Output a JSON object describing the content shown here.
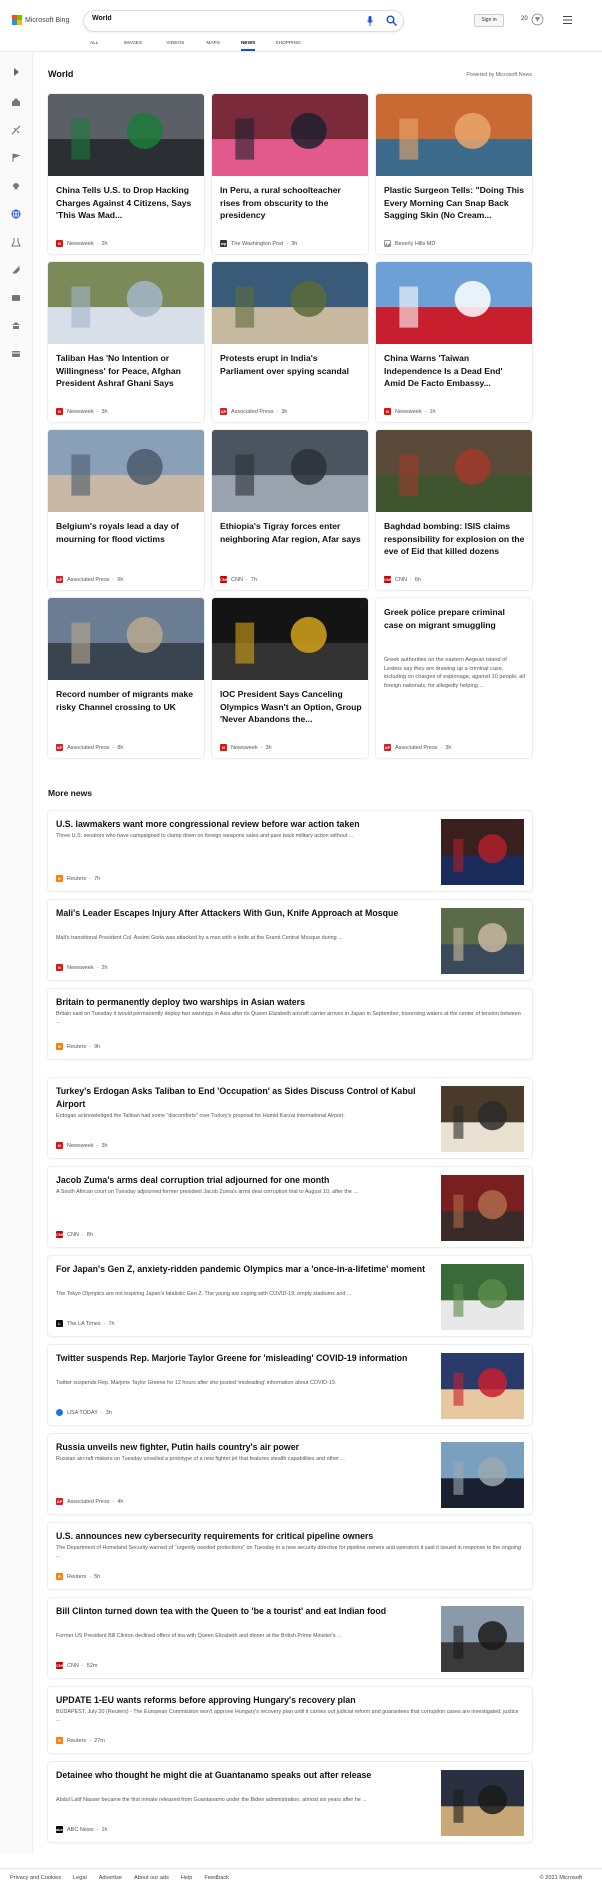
{
  "header": {
    "logo_text": "Microsoft Bing",
    "search_value": "World",
    "sign_in": "Sign in",
    "points": "20",
    "tabs": [
      "ALL",
      "IMAGES",
      "VIDEOS",
      "MAPS",
      "NEWS",
      "SHOPPING"
    ],
    "active_tab": "NEWS"
  },
  "sidebar": {
    "icons": [
      "expand-icon",
      "home-icon",
      "discover-icon",
      "flag-icon",
      "location-icon",
      "globe-icon",
      "science-icon",
      "rocket-icon",
      "entertainment-icon",
      "bank-icon",
      "card-icon"
    ]
  },
  "world": {
    "title": "World",
    "powered_by": "Powered by Microsoft News",
    "cards": [
      {
        "headline": "China Tells U.S. to Drop Hacking Charges Against 4 Citizens, Says 'This Was Mad...",
        "source": "Newsweek",
        "time": "2h",
        "logo": "N",
        "logo_color": "#e3120b"
      },
      {
        "headline": "In Peru, a rural schoolteacher rises from obscurity to the presidency",
        "source": "The Washington Post",
        "time": "3h",
        "logo": "wp",
        "logo_color": "#333333"
      },
      {
        "headline": "Plastic Surgeon Tells: \"Doing This Every Morning Can Snap Back Sagging Skin (No Cream...",
        "source": "Beverly Hills MD",
        "time": "",
        "logo": "Ad",
        "logo_color": "#cccccc"
      },
      {
        "headline": "Taliban Has 'No Intention or Willingness' for Peace, Afghan President Ashraf Ghani Says",
        "source": "Newsweek",
        "time": "3h",
        "logo": "N",
        "logo_color": "#e3120b"
      },
      {
        "headline": "Protests erupt in India's Parliament over spying scandal",
        "source": "Associated Press",
        "time": "3h",
        "logo": "AP",
        "logo_color": "#e31b23"
      },
      {
        "headline": "China Warns 'Taiwan Independence Is a Dead End' Amid De Facto Embassy...",
        "source": "Newsweek",
        "time": "1h",
        "logo": "N",
        "logo_color": "#e3120b"
      },
      {
        "headline": "Belgium's royals lead a day of mourning for flood victims",
        "source": "Associated Press",
        "time": "6h",
        "logo": "AP",
        "logo_color": "#e31b23"
      },
      {
        "headline": "Ethiopia's Tigray forces enter neighboring Afar region, Afar says",
        "source": "CNN",
        "time": "7h",
        "logo": "CNN",
        "logo_color": "#cc0000"
      },
      {
        "headline": "Baghdad bombing: ISIS claims responsibility for explosion on the eve of Eid that killed dozens",
        "source": "CNN",
        "time": "6h",
        "logo": "CNN",
        "logo_color": "#cc0000"
      },
      {
        "headline": "Record number of migrants make risky Channel crossing to UK",
        "source": "Associated Press",
        "time": "8h",
        "logo": "AP",
        "logo_color": "#e31b23"
      },
      {
        "headline": "IOC President Says Canceling Olympics Wasn't an Option, Group 'Never Abandons the...",
        "source": "Newsweek",
        "time": "3h",
        "logo": "N",
        "logo_color": "#e3120b"
      }
    ],
    "text_card": {
      "headline": "Greek police prepare criminal case on migrant smuggling",
      "snippet": "Greek authorities on the eastern Aegean island of Lesbos say they are drawing up a criminal case, including on charges of espionage, against 10 people, all foreign nationals, for allegedly helping ...",
      "source": "Associated Press",
      "time": "3h",
      "logo": "AP",
      "logo_color": "#e31b23"
    }
  },
  "more_news": {
    "title": "More news",
    "items": [
      {
        "title": "U.S. lawmakers want more congressional review before war action taken",
        "snippet": "Three U.S. senators who have campaigned to clamp down on foreign weapons sales and pare back military action without ...",
        "source": "Reuters",
        "time": "7h",
        "logo": "R",
        "logo_color": "#ff8000",
        "thumb": true
      },
      {
        "title": "Mali's Leader Escapes Injury After Attackers With Gun, Knife Approach at Mosque",
        "snippet": "Mali's transitional President Col. Assimi Goita was attacked by a man with a knife at the Grand Central Mosque during ...",
        "source": "Newsweek",
        "time": "2h",
        "logo": "N",
        "logo_color": "#e3120b",
        "thumb": true
      },
      {
        "title": "Britain to permanently deploy two warships in Asian waters",
        "snippet": "Britain said on Tuesday it would permanently deploy two warships in Asia after its Queen Elizabeth aircraft carrier arrives in Japan in September, traversing waters at the center of tension between ...",
        "source": "Reuters",
        "time": "9h",
        "logo": "R",
        "logo_color": "#ff8000",
        "thumb": false
      },
      {
        "title": "Turkey's Erdogan Asks Taliban to End 'Occupation' as Sides Discuss Control of Kabul Airport",
        "snippet": "Erdogan acknowledged the Taliban had some \"discomforts\" over Turkey's proposal for Hamid Karzai International Airport.",
        "source": "Newsweek",
        "time": "3h",
        "logo": "N",
        "logo_color": "#e3120b",
        "thumb": true
      },
      {
        "title": "Jacob Zuma's arms deal corruption trial adjourned for one month",
        "snippet": "A South African court on Tuesday adjourned former president Jacob Zuma's arms deal corruption trial to August 10, after the ...",
        "source": "CNN",
        "time": "8h",
        "logo": "CNN",
        "logo_color": "#cc0000",
        "thumb": true
      },
      {
        "title": "For Japan's Gen Z, anxiety-ridden pandemic Olympics mar a 'once-in-a-lifetime' moment",
        "snippet": "The Tokyo Olympics are not inspiring Japan's fatalistic Gen Z. The young are coping with COVID-19, empty stadiums and ...",
        "source": "The LA Times",
        "time": "7h",
        "logo": "L",
        "logo_color": "#111111",
        "thumb": true
      },
      {
        "title": "Twitter suspends Rep. Marjorie Taylor Greene for 'misleading' COVID-19 information",
        "snippet": "Twitter suspends Rep. Marjorie Taylor Greene for 12 hours after she posted 'misleading' information about COVID-19.",
        "source": "USA TODAY",
        "time": "3h",
        "logo": "",
        "logo_color": "#1a73e8",
        "thumb": true
      },
      {
        "title": "Russia unveils new fighter, Putin hails country's air power",
        "snippet": "Russian aircraft makers on Tuesday unveiled a prototype of a new fighter jet that features stealth capabilities and other ...",
        "source": "Associated Press",
        "time": "4h",
        "logo": "AP",
        "logo_color": "#e31b23",
        "thumb": true
      },
      {
        "title": "U.S. announces new cybersecurity requirements for critical pipeline owners",
        "snippet": "The Department of Homeland Security warned of \"urgently needed protections\" on Tuesday in a new security directive for pipeline owners and operators it said it issued in response to the ongoing ...",
        "source": "Reuters",
        "time": "5h",
        "logo": "R",
        "logo_color": "#ff8000",
        "thumb": false
      },
      {
        "title": "Bill Clinton turned down tea with the Queen to 'be a tourist' and eat Indian food",
        "snippet": "Former US President Bill Clinton declined offers of tea with Queen Elizabeth and dinner at the British Prime Minister's ...",
        "source": "CNN",
        "time": "52m",
        "logo": "CNN",
        "logo_color": "#cc0000",
        "thumb": true
      },
      {
        "title": "UPDATE 1-EU wants reforms before approving Hungary's recovery plan",
        "snippet": "BUDAPEST, July 20 (Reuters) - The European Commission won't approve Hungary's recovery plan until it carries out judicial reform and guarantees that corruption cases are investigated, justice ...",
        "source": "Reuters",
        "time": "27m",
        "logo": "R",
        "logo_color": "#ff8000",
        "thumb": false
      },
      {
        "title": "Detainee who thought he might die at Guantanamo speaks out after release",
        "snippet": "Abdul Latif Nasser became the first inmate released from Guantanamo under the Biden administration, almost six years after he ...",
        "source": "ABC News",
        "time": "1h",
        "logo": "abc",
        "logo_color": "#000000",
        "thumb": true
      }
    ]
  },
  "footer": {
    "links": [
      "Privacy and Cookies",
      "Legal",
      "Advertise",
      "About our ads",
      "Help",
      "Feedback"
    ],
    "copyright": "© 2021 Microsoft"
  }
}
